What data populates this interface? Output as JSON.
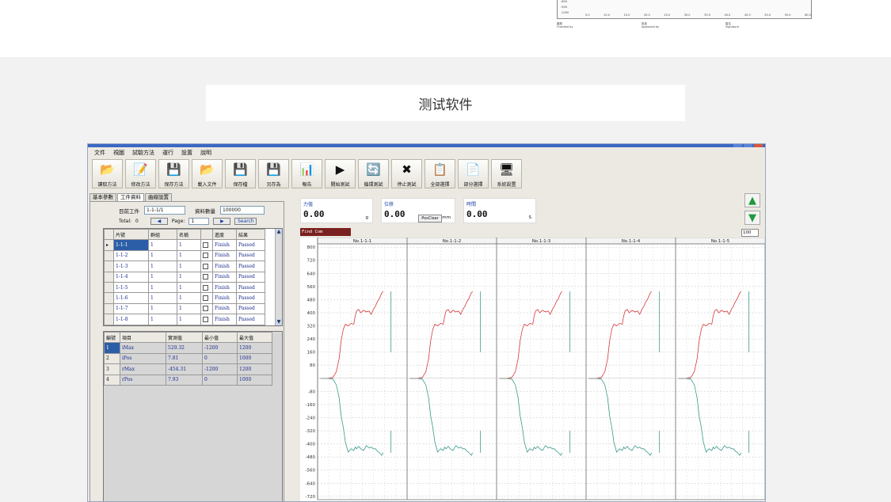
{
  "mini_report": {
    "y_ticks": [
      "-800",
      "-900",
      "-1000"
    ],
    "x_ticks": [
      "5.0",
      "10.0",
      "15.0",
      "20.0",
      "25.0",
      "30.0",
      "35.0",
      "40.0",
      "45.0",
      "50.0",
      "55.0",
      "60.0"
    ],
    "signatures": [
      {
        "zh": "審核",
        "en": "Checked by"
      },
      {
        "zh": "批准",
        "en": "Approved by"
      },
      {
        "zh": "簽名",
        "en": "Signature"
      }
    ]
  },
  "caption": "测试软件",
  "menu": [
    "文件",
    "視圖",
    "試驗方法",
    "運行",
    "設置",
    "說明"
  ],
  "toolbar": [
    {
      "label": "讀取方法",
      "icon": "📂"
    },
    {
      "label": "修改方法",
      "icon": "📝"
    },
    {
      "label": "保存方法",
      "icon": "💾"
    },
    {
      "label": "載入文件",
      "icon": "📂"
    },
    {
      "label": "保存檔",
      "icon": "💾"
    },
    {
      "label": "另存為",
      "icon": "💾"
    },
    {
      "label": "報告",
      "icon": "📊"
    },
    {
      "label": "開始測試",
      "icon": "▶"
    },
    {
      "label": "循環測試",
      "icon": "🔄"
    },
    {
      "label": "停止測試",
      "icon": "✖"
    },
    {
      "label": "全部選擇",
      "icon": "📋"
    },
    {
      "label": "部分選擇",
      "icon": "📄"
    },
    {
      "label": "系統設置",
      "icon": "🖥"
    }
  ],
  "tabs": [
    "基本參數",
    "工件資料",
    "曲線設置"
  ],
  "workpiece": {
    "current_label": "目前工件",
    "current_value": "1-1-1/1",
    "count_label": "資料數量",
    "count_value": "100000",
    "total_label": "Total:",
    "total_value": "0",
    "page_label": "Page:",
    "page_value": "1",
    "search": "Search"
  },
  "table1": {
    "headers": [
      "片號",
      "群組",
      "名稱",
      "",
      "進度",
      "結果"
    ],
    "rows": [
      [
        "1-1-1",
        "1",
        "1",
        "Finish",
        "Passed"
      ],
      [
        "1-1-2",
        "1",
        "1",
        "Finish",
        "Passed"
      ],
      [
        "1-1-3",
        "1",
        "1",
        "Finish",
        "Passed"
      ],
      [
        "1-1-4",
        "1",
        "1",
        "Finish",
        "Passed"
      ],
      [
        "1-1-5",
        "1",
        "1",
        "Finish",
        "Passed"
      ],
      [
        "1-1-6",
        "1",
        "1",
        "Finish",
        "Passed"
      ],
      [
        "1-1-7",
        "1",
        "1",
        "Finish",
        "Passed"
      ],
      [
        "1-1-8",
        "1",
        "1",
        "Finish",
        "Passed"
      ]
    ]
  },
  "table2": {
    "headers": [
      "編號",
      "項目",
      "實測值",
      "最小值",
      "最大值"
    ],
    "rows": [
      [
        "1",
        "iMax",
        "529.32",
        "-1200",
        "1200"
      ],
      [
        "2",
        "iPos",
        "7.81",
        "0",
        "1000"
      ],
      [
        "3",
        "rMax",
        "-454.31",
        "-1200",
        "1200"
      ],
      [
        "4",
        "rPos",
        "7.93",
        "0",
        "1000"
      ]
    ]
  },
  "readouts": {
    "force": {
      "title": "力值",
      "value": "0.00",
      "unit": "g"
    },
    "disp": {
      "title": "位移",
      "value": "0.00",
      "unit": "mm",
      "button": "PosClear"
    },
    "time": {
      "title": "時間",
      "value": "0.00",
      "unit": "S"
    }
  },
  "status_text": "Find Com",
  "zoom_value": "100",
  "colors": {
    "upper": "#d63a3a",
    "lower": "#3a9a8a",
    "status_bg": "#7a2020"
  },
  "chart_data": {
    "type": "line",
    "panels": [
      "No.1-1-1",
      "No.1-1-2",
      "No.1-1-3",
      "No.1-1-4",
      "No.1-1-5"
    ],
    "y_ticks": [
      800,
      720,
      640,
      560,
      480,
      400,
      320,
      240,
      160,
      80,
      -80,
      -160,
      -240,
      -320,
      -400,
      -480,
      -560,
      -640,
      -720
    ],
    "ylim": [
      -740,
      820
    ],
    "x": [
      0,
      0.1,
      0.18,
      0.23,
      0.27,
      0.3,
      0.33,
      0.36,
      0.4,
      0.44,
      0.48,
      0.5,
      0.52,
      0.55,
      0.58,
      0.62,
      0.66,
      0.7,
      0.73,
      0.76,
      0.79,
      0.82,
      0.84,
      0.86,
      0.88,
      0.9
    ],
    "series": [
      {
        "values": [
          0,
          0,
          5,
          40,
          120,
          230,
          300,
          330,
          320,
          335,
          330,
          380,
          410,
          420,
          400,
          415,
          405,
          410,
          390,
          420,
          440,
          470,
          480,
          500,
          520,
          530
        ]
      },
      {
        "values": [
          0,
          0,
          -5,
          -40,
          -120,
          -230,
          -300,
          -390,
          -450,
          -430,
          -440,
          -420,
          -430,
          -415,
          -430,
          -440,
          -410,
          -425,
          -420,
          -430,
          -430,
          -445,
          -450,
          -460,
          -470,
          -454
        ]
      }
    ]
  }
}
